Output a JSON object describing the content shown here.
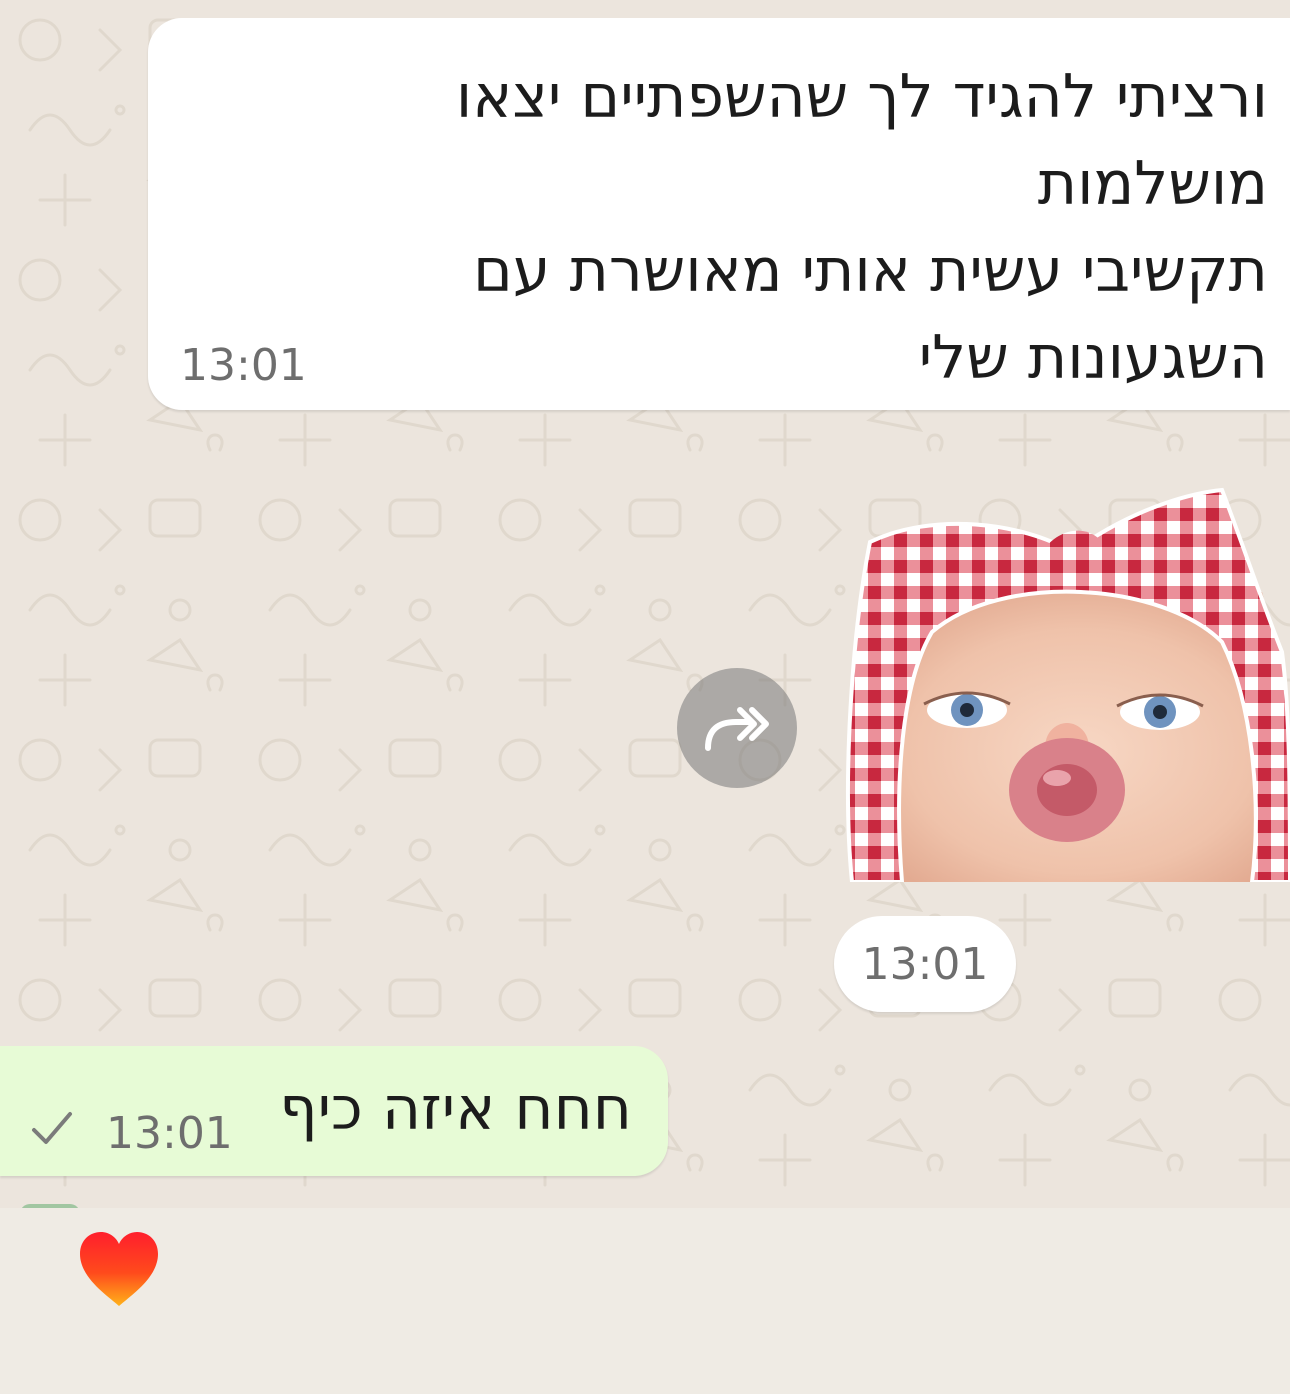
{
  "incoming_message": {
    "text": "ורציתי להגיד לך שהשפתיים יצאו\nמושלמות\nתקשיבי עשית אותי מאושרת עם\nהשגעונות שלי",
    "time": "13:01"
  },
  "sticker": {
    "description_icon": "baby-kiss-sticker",
    "time": "13:01",
    "forward_icon": "forward-icon"
  },
  "outgoing_message": {
    "text": "חחח איזה כיף",
    "time": "13:01",
    "status_icon": "single-check-icon"
  },
  "reaction": {
    "icon": "heart-icon"
  }
}
